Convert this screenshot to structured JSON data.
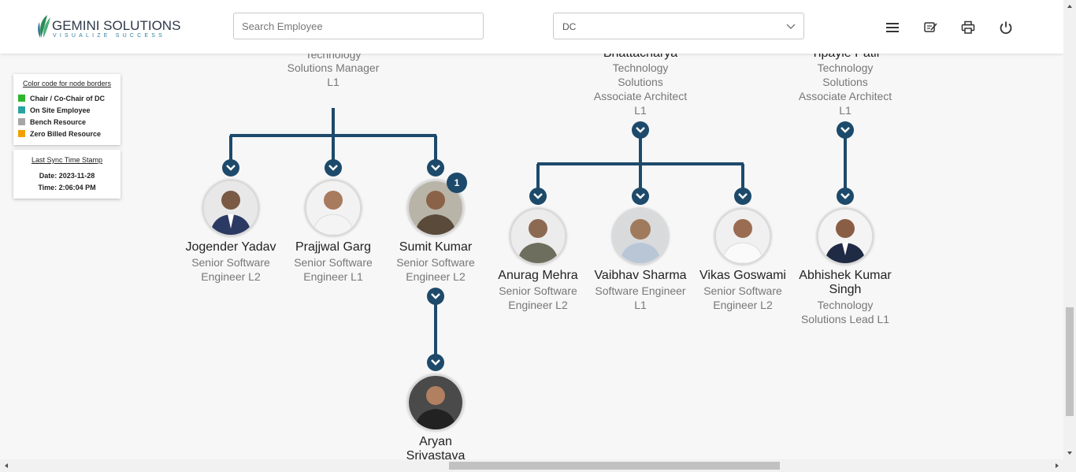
{
  "header": {
    "logo_main": "GEMINI SOLUTIONS",
    "logo_tagline": "VISUALIZE SUCCESS",
    "search_placeholder": "Search Employee",
    "dc_select_value": "DC",
    "icons": [
      "menu-icon",
      "notes-icon",
      "print-icon",
      "power-icon"
    ]
  },
  "legend": {
    "title": "Color code for node borders",
    "items": [
      {
        "label": "Chair / Co-Chair of DC",
        "color": "#2db52d"
      },
      {
        "label": "On Site Employee",
        "color": "#2aa2a2"
      },
      {
        "label": "Bench Resource",
        "color": "#a6a6a6"
      },
      {
        "label": "Zero Billed Resource",
        "color": "#f0a000"
      }
    ]
  },
  "sync": {
    "title": "Last Sync Time Stamp",
    "date": "Date: 2023-11-28",
    "time": "Time: 2:06:04 PM"
  },
  "parents": [
    {
      "name_fragment": "",
      "role_lines": [
        "Technology",
        "Solutions Manager",
        "L1"
      ]
    },
    {
      "name_fragment": "Bhattacharya",
      "role_lines": [
        "Technology",
        "Solutions",
        "Associate Architect",
        "L1"
      ]
    },
    {
      "name_fragment": "Tipayle Patil",
      "role_lines": [
        "Technology",
        "Solutions",
        "Associate Architect",
        "L1"
      ]
    }
  ],
  "nodes": [
    {
      "name": "Jogender Yadav",
      "role_lines": [
        "Senior Software",
        "Engineer L2"
      ]
    },
    {
      "name": "Prajjwal Garg",
      "role_lines": [
        "Senior Software",
        "Engineer L1"
      ]
    },
    {
      "name": "Sumit Kumar",
      "role_lines": [
        "Senior Software",
        "Engineer L2"
      ],
      "badge": "1"
    },
    {
      "name": "Anurag Mehra",
      "role_lines": [
        "Senior Software",
        "Engineer L2"
      ]
    },
    {
      "name": "Vaibhav Sharma",
      "role_lines": [
        "Software Engineer",
        "L1"
      ]
    },
    {
      "name": "Vikas Goswami",
      "role_lines": [
        "Senior Software",
        "Engineer L2"
      ]
    },
    {
      "name": "Abhishek Kumar",
      "name2": "Singh",
      "role_lines": [
        "Technology",
        "Solutions Lead L1"
      ]
    },
    {
      "name": "Aryan",
      "name2": "Srivastava",
      "role_lines": []
    }
  ],
  "colors": {
    "connector": "#1d4a6b",
    "accent": "#1d4a6b"
  }
}
